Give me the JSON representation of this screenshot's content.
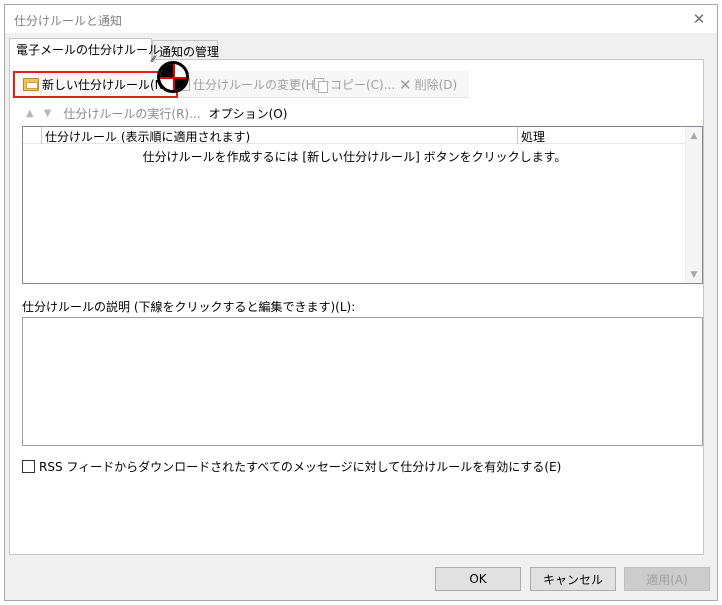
{
  "window": {
    "title": "仕分けルールと通知",
    "close_glyph": "✕"
  },
  "tabs": [
    {
      "label": "電子メールの仕分けルール",
      "active": true
    },
    {
      "label": "通知の管理",
      "active": false
    }
  ],
  "toolbar": {
    "new_rule": "新しい仕分けルール(N)...",
    "change_rule": "仕分けルールの変更(H)",
    "copy": "コピー(C)...",
    "delete": "削除(D)",
    "dropdown_glyph": "▼"
  },
  "row2": {
    "up_glyph": "▲",
    "down_glyph": "▼",
    "run_rules": "仕分けルールの実行(R)...",
    "options": "オプション(O)"
  },
  "rules_list": {
    "col_rule": "仕分けルール (表示順に適用されます)",
    "col_action": "処理",
    "empty_message": "仕分けルールを作成するには [新しい仕分けルール] ボタンをクリックします。",
    "scroll_up_glyph": "▲",
    "scroll_down_glyph": "▼"
  },
  "description": {
    "label": "仕分けルールの説明 (下線をクリックすると編集できます)(L):"
  },
  "rss": {
    "label": "RSS フィードからダウンロードされたすべてのメッセージに対して仕分けルールを有効にする(E)",
    "checked": false
  },
  "buttons": {
    "ok": "OK",
    "cancel": "キャンセル",
    "apply": "適用(A)"
  },
  "colors": {
    "highlight": "#e02020",
    "disabled_text": "#a0a0a0",
    "dialog_bg": "#f0f0f0"
  }
}
